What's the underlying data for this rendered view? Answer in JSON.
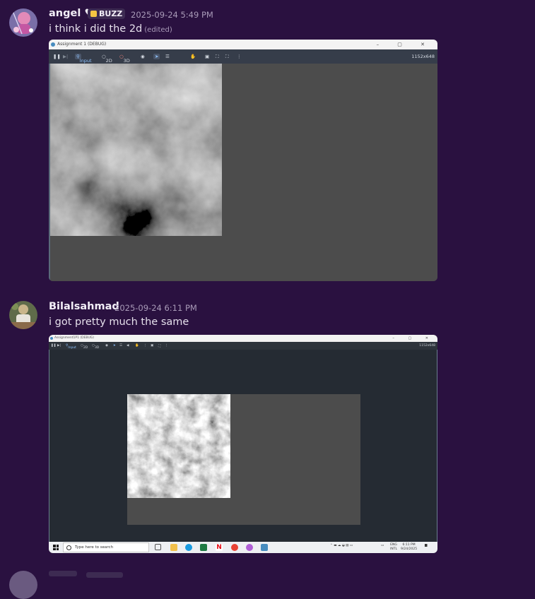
{
  "messages": [
    {
      "author": "angel ♥",
      "badge": "BUZZ",
      "timestamp": "2025-09-24 5:49 PM",
      "text": "i think i did the 2d",
      "edited": "(edited)",
      "attachment": {
        "window_title": "Assignment 1 (DEBUG)",
        "toolbar": {
          "input": "Input",
          "mode_2d": "2D",
          "mode_3d": "3D",
          "resolution": "1152x648"
        }
      }
    },
    {
      "author": "Bilalsahmad",
      "timestamp": "2025-09-24 6:11 PM",
      "text": "i got pretty much the same",
      "attachment": {
        "window_title": "Assignment1P1 (DEBUG)",
        "toolbar": {
          "input": "Input",
          "mode_2d": "2D",
          "mode_3d": "3D",
          "resolution": "1152x648"
        },
        "taskbar": {
          "search_placeholder": "Type here to search",
          "lang_1": "ENG",
          "lang_2": "INTL",
          "time": "6:11 PM",
          "date": "9/24/2025"
        }
      }
    }
  ],
  "colors": {
    "background": "#2a1140",
    "username": "#f2eef7",
    "timestamp": "#a99bb8",
    "badge_icon": "#f5c542",
    "godot_toolbar": "#363d4a",
    "godot_viewport": "#4c4c4c"
  }
}
